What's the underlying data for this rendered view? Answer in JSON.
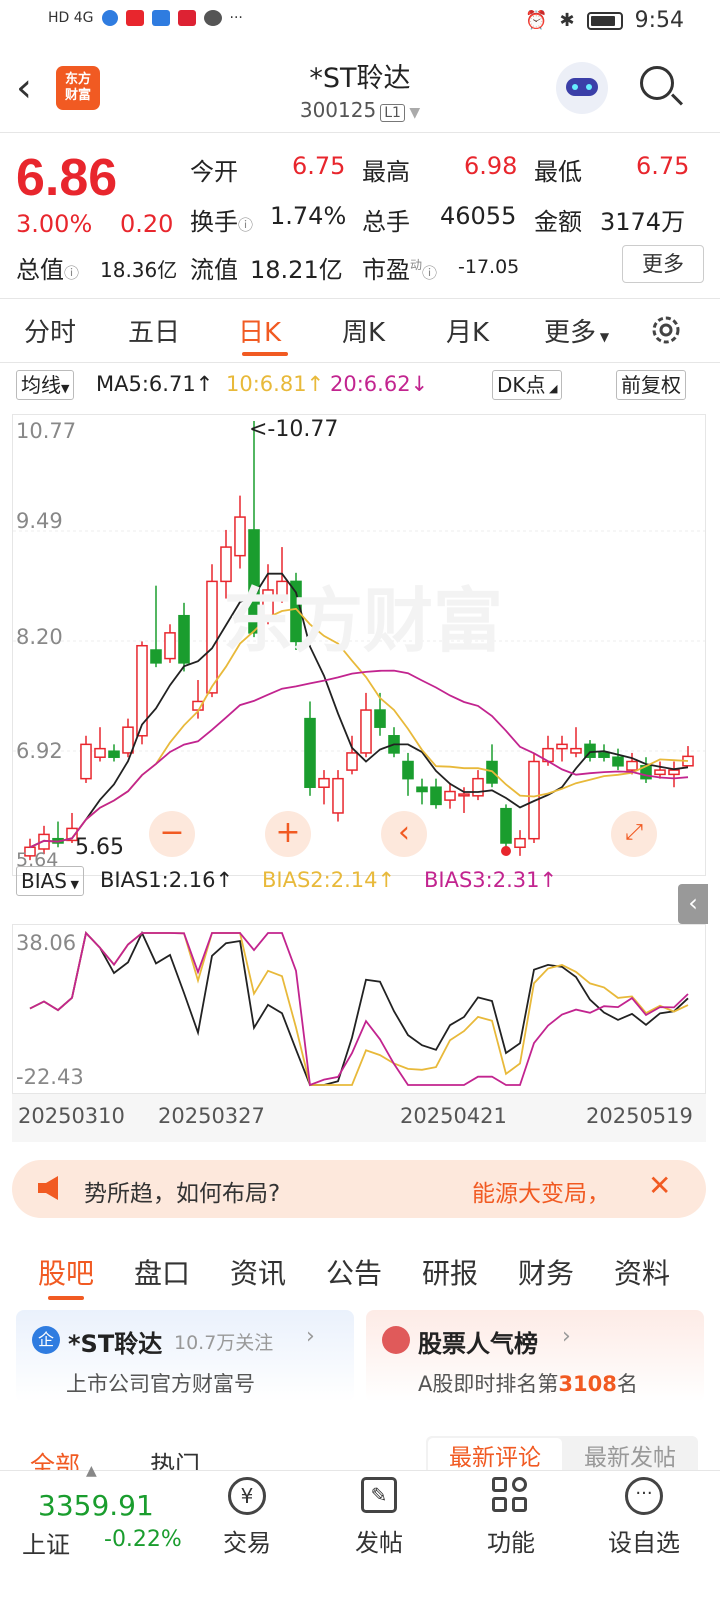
{
  "status_bar": {
    "time": "9:54",
    "net": "HD 4G"
  },
  "header": {
    "title": "*ST聆达",
    "code": "300125",
    "level": "L1",
    "logo": "东方财富"
  },
  "quote": {
    "price": "6.86",
    "pct": "3.00%",
    "change": "0.20",
    "open_label": "今开",
    "open": "6.75",
    "high_label": "最高",
    "high": "6.98",
    "low_label": "最低",
    "low": "6.75",
    "turnover_label": "换手",
    "turnover": "1.74%",
    "volume_label": "总手",
    "volume": "46055",
    "amount_label": "金额",
    "amount": "3174万",
    "mcap_label": "总值",
    "mcap": "18.36亿",
    "float_label": "流值",
    "float": "18.21亿",
    "pe_label": "市盈",
    "pe_sup": "动",
    "pe": "-17.05",
    "more_btn": "更多"
  },
  "tabs": [
    "分时",
    "五日",
    "日K",
    "周K",
    "月K",
    "更多"
  ],
  "ma_row": {
    "select": "均线",
    "ma5": "MA5:6.71↑",
    "ma10": "10:6.81↑",
    "ma20": "20:6.62↓",
    "dk": "DK点",
    "fq": "前复权"
  },
  "kline": {
    "y_labels": [
      "10.77",
      "9.49",
      "8.20",
      "6.92",
      "5.64"
    ],
    "max_label": "<-10.77",
    "min_label": "5.65",
    "watermark": "东方财富",
    "colors": {
      "up": "#e8262d",
      "down": "#1a9d2e",
      "ma5": "#222222",
      "ma10": "#e8b93a",
      "ma20": "#c2248f"
    }
  },
  "bias_row": {
    "select": "BIAS",
    "bias1": "BIAS1:2.16↑",
    "bias2": "BIAS2:2.14↑",
    "bias3": "BIAS3:2.31↑"
  },
  "bias": {
    "y_labels": [
      "38.06",
      "-22.43"
    ]
  },
  "dates": [
    "20250310",
    "20250327",
    "20250421",
    "20250519"
  ],
  "chart_data": {
    "type": "candlestick",
    "ylim": [
      5.64,
      10.77
    ],
    "candles": [
      {
        "o": 5.7,
        "c": 5.8,
        "h": 5.9,
        "l": 5.65
      },
      {
        "o": 5.78,
        "c": 5.95,
        "h": 6.05,
        "l": 5.72
      },
      {
        "o": 5.9,
        "c": 5.85,
        "h": 6.1,
        "l": 5.8
      },
      {
        "o": 5.88,
        "c": 6.02,
        "h": 6.2,
        "l": 5.85
      },
      {
        "o": 6.6,
        "c": 7.0,
        "h": 7.1,
        "l": 6.55
      },
      {
        "o": 6.85,
        "c": 6.95,
        "h": 7.2,
        "l": 6.8
      },
      {
        "o": 6.92,
        "c": 6.85,
        "h": 7.0,
        "l": 6.8
      },
      {
        "o": 6.9,
        "c": 7.2,
        "h": 7.3,
        "l": 6.85
      },
      {
        "o": 7.1,
        "c": 8.15,
        "h": 8.2,
        "l": 7.0
      },
      {
        "o": 8.1,
        "c": 7.95,
        "h": 8.85,
        "l": 7.9
      },
      {
        "o": 8.0,
        "c": 8.3,
        "h": 8.4,
        "l": 7.95
      },
      {
        "o": 8.5,
        "c": 7.95,
        "h": 8.65,
        "l": 7.85
      },
      {
        "o": 7.4,
        "c": 7.5,
        "h": 7.75,
        "l": 7.3
      },
      {
        "o": 7.6,
        "c": 8.9,
        "h": 9.1,
        "l": 7.55
      },
      {
        "o": 8.9,
        "c": 9.3,
        "h": 9.5,
        "l": 8.7
      },
      {
        "o": 9.2,
        "c": 9.65,
        "h": 9.9,
        "l": 9.05
      },
      {
        "o": 9.5,
        "c": 8.3,
        "h": 10.77,
        "l": 8.25
      },
      {
        "o": 8.5,
        "c": 8.8,
        "h": 9.1,
        "l": 8.4
      },
      {
        "o": 8.7,
        "c": 8.9,
        "h": 9.3,
        "l": 8.65
      },
      {
        "o": 8.9,
        "c": 8.2,
        "h": 9.0,
        "l": 8.1
      },
      {
        "o": 7.3,
        "c": 6.5,
        "h": 7.5,
        "l": 6.4
      },
      {
        "o": 6.5,
        "c": 6.6,
        "h": 6.7,
        "l": 6.3
      },
      {
        "o": 6.2,
        "c": 6.6,
        "h": 6.7,
        "l": 6.1
      },
      {
        "o": 6.7,
        "c": 6.9,
        "h": 7.1,
        "l": 6.65
      },
      {
        "o": 6.9,
        "c": 7.4,
        "h": 7.6,
        "l": 6.85
      },
      {
        "o": 7.4,
        "c": 7.2,
        "h": 7.6,
        "l": 7.1
      },
      {
        "o": 7.1,
        "c": 6.9,
        "h": 7.2,
        "l": 6.85
      },
      {
        "o": 6.8,
        "c": 6.6,
        "h": 6.9,
        "l": 6.4
      },
      {
        "o": 6.5,
        "c": 6.45,
        "h": 6.6,
        "l": 6.3
      },
      {
        "o": 6.5,
        "c": 6.3,
        "h": 6.6,
        "l": 6.25
      },
      {
        "o": 6.35,
        "c": 6.45,
        "h": 6.55,
        "l": 6.25
      },
      {
        "o": 6.4,
        "c": 6.42,
        "h": 6.5,
        "l": 6.2
      },
      {
        "o": 6.4,
        "c": 6.6,
        "h": 6.7,
        "l": 6.35
      },
      {
        "o": 6.8,
        "c": 6.55,
        "h": 7.0,
        "l": 6.5
      },
      {
        "o": 6.25,
        "c": 5.85,
        "h": 6.3,
        "l": 5.8
      },
      {
        "o": 5.8,
        "c": 5.9,
        "h": 6.0,
        "l": 5.7
      },
      {
        "o": 5.9,
        "c": 6.8,
        "h": 6.9,
        "l": 5.85
      },
      {
        "o": 6.8,
        "c": 6.95,
        "h": 7.1,
        "l": 6.75
      },
      {
        "o": 6.95,
        "c": 7.0,
        "h": 7.1,
        "l": 6.8
      },
      {
        "o": 6.9,
        "c": 6.95,
        "h": 7.2,
        "l": 6.85
      },
      {
        "o": 7.0,
        "c": 6.85,
        "h": 7.05,
        "l": 6.8
      },
      {
        "o": 6.9,
        "c": 6.85,
        "h": 7.0,
        "l": 6.8
      },
      {
        "o": 6.85,
        "c": 6.75,
        "h": 6.95,
        "l": 6.7
      },
      {
        "o": 6.7,
        "c": 6.8,
        "h": 6.9,
        "l": 6.65
      },
      {
        "o": 6.75,
        "c": 6.6,
        "h": 6.85,
        "l": 6.55
      },
      {
        "o": 6.65,
        "c": 6.7,
        "h": 6.8,
        "l": 6.6
      },
      {
        "o": 6.65,
        "c": 6.7,
        "h": 6.8,
        "l": 6.5
      },
      {
        "o": 6.75,
        "c": 6.86,
        "h": 6.98,
        "l": 6.75
      }
    ]
  },
  "banner": {
    "left_text": "势所趋，如何布局?",
    "right_text": "能源大变局，"
  },
  "post_tabs": [
    "股吧",
    "盘口",
    "资讯",
    "公告",
    "研报",
    "财务",
    "资料"
  ],
  "card_left": {
    "badge": "企",
    "name": "*ST聆达",
    "follow": "10.7万关注",
    "sub": "上市公司官方财富号"
  },
  "card_right": {
    "title": "股票人气榜",
    "sub_a": "A股即时排名第",
    "rank": "3108",
    "sub_b": "名"
  },
  "filter": {
    "all": "全部",
    "hot": "热门",
    "latest_comment": "最新评论",
    "latest_post": "最新发帖"
  },
  "index": {
    "value": "3359.91",
    "name": "上证",
    "change": "-0.22%"
  },
  "bottom_nav": [
    "交易",
    "发帖",
    "功能",
    "设自选"
  ]
}
